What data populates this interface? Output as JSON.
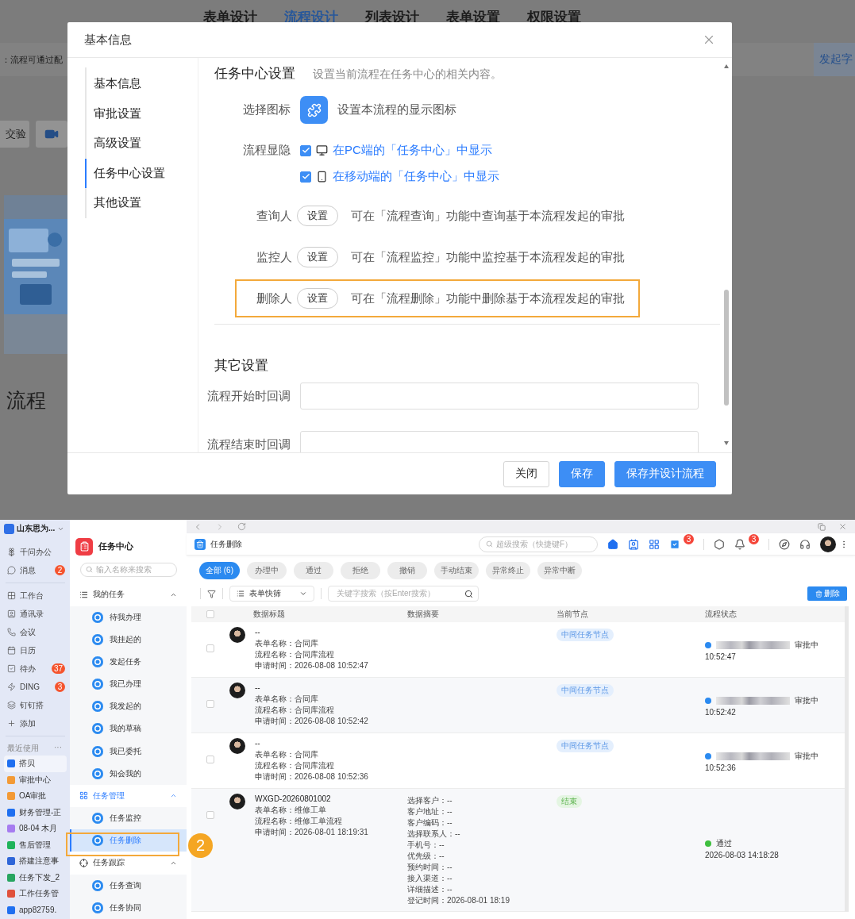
{
  "background": {
    "nav_tabs": [
      {
        "label": "表单设计",
        "selected": false
      },
      {
        "label": "流程设计",
        "selected": true
      },
      {
        "label": "列表设计",
        "selected": false
      },
      {
        "label": "表单设置",
        "selected": false
      },
      {
        "label": "权限设置",
        "selected": false
      }
    ],
    "notice": "：流程可通过配",
    "start_button": "发起字",
    "verify_button": "交验",
    "heading": "流程"
  },
  "dialog": {
    "title": "基本信息",
    "menu": [
      {
        "label": "基本信息",
        "selected": false
      },
      {
        "label": "审批设置",
        "selected": false
      },
      {
        "label": "高级设置",
        "selected": false
      },
      {
        "label": "任务中心设置",
        "selected": true
      },
      {
        "label": "其他设置",
        "selected": false
      }
    ],
    "section": {
      "title": "任务中心设置",
      "description": "设置当前流程在任务中心的相关内容。"
    },
    "icon_row": {
      "label": "选择图标",
      "hint": "设置本流程的显示图标"
    },
    "visibility": {
      "label": "流程显隐",
      "options": [
        {
          "kind": "desktop",
          "text": "在PC端的「任务中心」中显示",
          "checked": true
        },
        {
          "kind": "mobile",
          "text": "在移动端的「任务中心」中显示",
          "checked": true
        }
      ]
    },
    "roles": [
      {
        "label": "查询人",
        "button": "设置",
        "description": "可在「流程查询」功能中查询基于本流程发起的审批",
        "highlighted": false
      },
      {
        "label": "监控人",
        "button": "设置",
        "description": "可在「流程监控」功能中监控基于本流程发起的审批",
        "highlighted": false
      },
      {
        "label": "删除人",
        "button": "设置",
        "description": "可在「流程删除」功能中删除基于本流程发起的审批",
        "highlighted": true
      }
    ],
    "other": {
      "title": "其它设置",
      "fields": [
        {
          "label": "流程开始时回调"
        },
        {
          "label": "流程结束时回调"
        }
      ]
    },
    "buttons": [
      {
        "label": "关闭",
        "kind": "default"
      },
      {
        "label": "保存",
        "kind": "primary"
      },
      {
        "label": "保存并设计流程",
        "kind": "primary"
      }
    ]
  },
  "app": {
    "rail": {
      "org": "山东思为...",
      "items": [
        {
          "kind": "assistant",
          "label": "千问办公"
        },
        {
          "kind": "message",
          "label": "消息",
          "badge": "2"
        },
        {
          "kind": "workbench",
          "label": "工作台"
        },
        {
          "kind": "contacts",
          "label": "通讯录"
        },
        {
          "kind": "meeting",
          "label": "会议"
        },
        {
          "kind": "calendar",
          "label": "日历"
        },
        {
          "kind": "todo",
          "label": "待办",
          "badge": "37"
        },
        {
          "kind": "ding",
          "label": "DING",
          "badge": "3"
        },
        {
          "kind": "builder",
          "label": "钉钉搭"
        },
        {
          "kind": "add",
          "label": "添加"
        }
      ],
      "recent_title": "最近使用",
      "recent_more": "···",
      "recent": [
        {
          "label": "搭贝",
          "color": "#1f6ff0",
          "selected": true
        },
        {
          "label": "审批中心",
          "color": "#f39a36",
          "selected": false
        },
        {
          "label": "OA审批",
          "color": "#f39a36",
          "selected": false
        },
        {
          "label": "财务管理-正",
          "color": "#1f6ff0",
          "selected": false
        },
        {
          "label": "08-04 木月",
          "color": "#a67cf0",
          "selected": false
        },
        {
          "label": "售后管理",
          "color": "#1fb35a",
          "selected": false
        },
        {
          "label": "搭建注意事",
          "color": "#2f66d8",
          "selected": false
        },
        {
          "label": "任务下发_2",
          "color": "#27a560",
          "selected": false
        },
        {
          "label": "工作任务管",
          "color": "#e0513c",
          "selected": false
        },
        {
          "label": "app82759.",
          "color": "#1f6ff0",
          "selected": false
        }
      ]
    },
    "panel": {
      "title": "任务中心",
      "search": {
        "placeholder": "输入名称来搜索"
      },
      "groups": [
        {
          "label": "我的任务",
          "expanded": true,
          "active": false,
          "children": [
            {
              "label": "待我办理",
              "selected": false
            },
            {
              "label": "我挂起的",
              "selected": false
            },
            {
              "label": "发起任务",
              "selected": false
            },
            {
              "label": "我已办理",
              "selected": false
            },
            {
              "label": "我发起的",
              "selected": false
            },
            {
              "label": "我的草稿",
              "selected": false
            },
            {
              "label": "我已委托",
              "selected": false
            },
            {
              "label": "知会我的",
              "selected": false
            }
          ]
        },
        {
          "label": "任务管理",
          "expanded": true,
          "active": true,
          "children": [
            {
              "label": "任务监控",
              "selected": false
            },
            {
              "label": "任务删除",
              "selected": true,
              "highlighted": true
            }
          ]
        },
        {
          "label": "任务跟踪",
          "expanded": true,
          "active": false,
          "children": [
            {
              "label": "任务查询",
              "selected": false
            },
            {
              "label": "任务协同",
              "selected": false
            }
          ]
        }
      ]
    },
    "callout": "2",
    "header": {
      "title": "任务删除",
      "search": {
        "placeholder": "超级搜索（快捷键F）"
      },
      "todo_badge": "3",
      "bell_badge": "3"
    },
    "filters": [
      {
        "label": "全部 (6)",
        "selected": true
      },
      {
        "label": "办理中",
        "selected": false
      },
      {
        "label": "通过",
        "selected": false
      },
      {
        "label": "拒绝",
        "selected": false
      },
      {
        "label": "撤销",
        "selected": false
      },
      {
        "label": "手动结束",
        "selected": false
      },
      {
        "label": "异常终止",
        "selected": false
      },
      {
        "label": "异常中断",
        "selected": false
      }
    ],
    "toolbar": {
      "quick_filter": "表单快筛",
      "keyword": {
        "placeholder": "关键字搜索（按Enter搜索）"
      },
      "delete_button": "删除"
    },
    "table": {
      "select_all_checked": false,
      "columns": [
        "数据标题",
        "数据摘要",
        "当前节点",
        "流程状态"
      ],
      "rows": [
        {
          "checked": false,
          "title": "--",
          "form": "表单名称：合同库",
          "process": "流程名称：合同库流程",
          "time": "申请时间：2026-08-08 10:52:47",
          "summary": [],
          "node": {
            "text": "中间任务节点",
            "kind": "running"
          },
          "status": {
            "kind": "running",
            "redacted": true,
            "text": "审批中",
            "time": "10:52:47"
          }
        },
        {
          "checked": false,
          "title": "--",
          "form": "表单名称：合同库",
          "process": "流程名称：合同库流程",
          "time": "申请时间：2026-08-08 10:52:42",
          "summary": [],
          "node": {
            "text": "中间任务节点",
            "kind": "running"
          },
          "status": {
            "kind": "running",
            "redacted": true,
            "text": "审批中",
            "time": "10:52:42"
          }
        },
        {
          "checked": false,
          "title": "--",
          "form": "表单名称：合同库",
          "process": "流程名称：合同库流程",
          "time": "申请时间：2026-08-08 10:52:36",
          "summary": [],
          "node": {
            "text": "中间任务节点",
            "kind": "running"
          },
          "status": {
            "kind": "running",
            "redacted": true,
            "text": "审批中",
            "time": "10:52:36"
          }
        },
        {
          "checked": false,
          "title": "WXGD-20260801002",
          "form": "表单名称：维修工单",
          "process": "流程名称：维修工单流程",
          "time": "申请时间：2026-08-01 18:19:31",
          "summary": [
            "选择客户：--",
            "客户地址：--",
            "客户编码：--",
            "选择联系人：--",
            "手机号：--",
            "优先级：--",
            "预约时间：--",
            "接入渠道：--",
            "详细描述：--",
            "登记时间：2026-08-01 18:19"
          ],
          "node": {
            "text": "结束",
            "kind": "done"
          },
          "status": {
            "kind": "passed",
            "redacted": false,
            "text": "通过",
            "time": "2026-08-03 14:18:28"
          }
        }
      ]
    }
  }
}
